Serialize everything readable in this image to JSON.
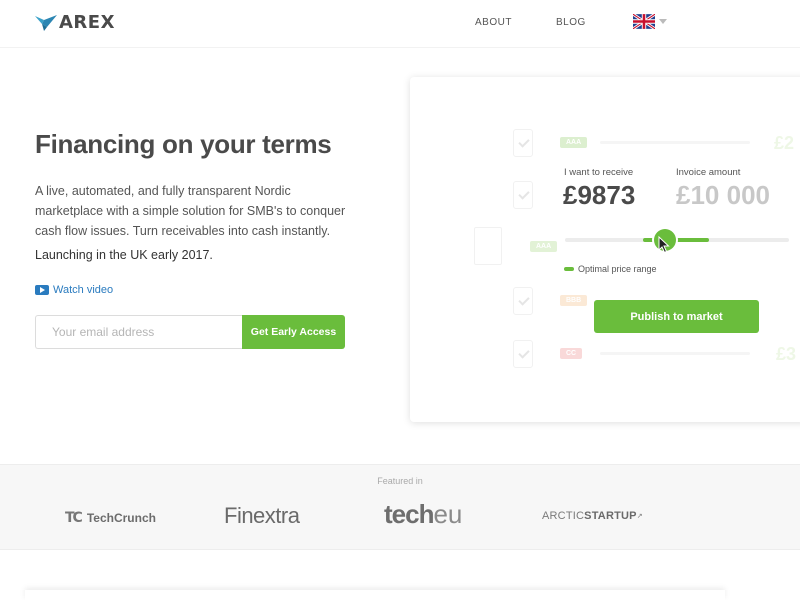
{
  "header": {
    "logo_text": "AREX",
    "nav": [
      {
        "label": "ABOUT"
      },
      {
        "label": "BLOG"
      }
    ],
    "language_flag": "uk-flag-icon"
  },
  "hero": {
    "title": "Financing on your terms",
    "description": "A live, automated, and fully transparent Nordic marketplace with a simple solution for SMB's to conquer cash flow issues. Turn receivables into cash instantly.",
    "launch_note": "Launching in the UK early 2017.",
    "watch_video_label": "Watch video",
    "email_placeholder": "Your email address",
    "cta_label": "Get Early Access"
  },
  "calculator": {
    "receive_label": "I want to receive",
    "receive_value": "£9873",
    "invoice_label": "Invoice amount",
    "invoice_value": "£10 000",
    "legend_label": "Optimal price range",
    "publish_label": "Publish to market",
    "ghost_rows": [
      {
        "badge": "AAA",
        "amount": "£2"
      },
      {
        "badge": "AAA",
        "amount": ""
      },
      {
        "badge": "BBB",
        "amount": ""
      },
      {
        "badge": "CC",
        "amount": "£3"
      }
    ]
  },
  "featured": {
    "label": "Featured in",
    "outlets": [
      {
        "name": "TechCrunch"
      },
      {
        "name": "Finextra"
      },
      {
        "name": "tech",
        "suffix": "eu"
      },
      {
        "name_light": "ARCTIC",
        "name_bold": "STARTUP"
      }
    ]
  },
  "colors": {
    "accent": "#6abd3c",
    "link": "#2a7bbf",
    "text_dark": "#4a4a4a",
    "featured_bg": "#f7f7f7"
  }
}
